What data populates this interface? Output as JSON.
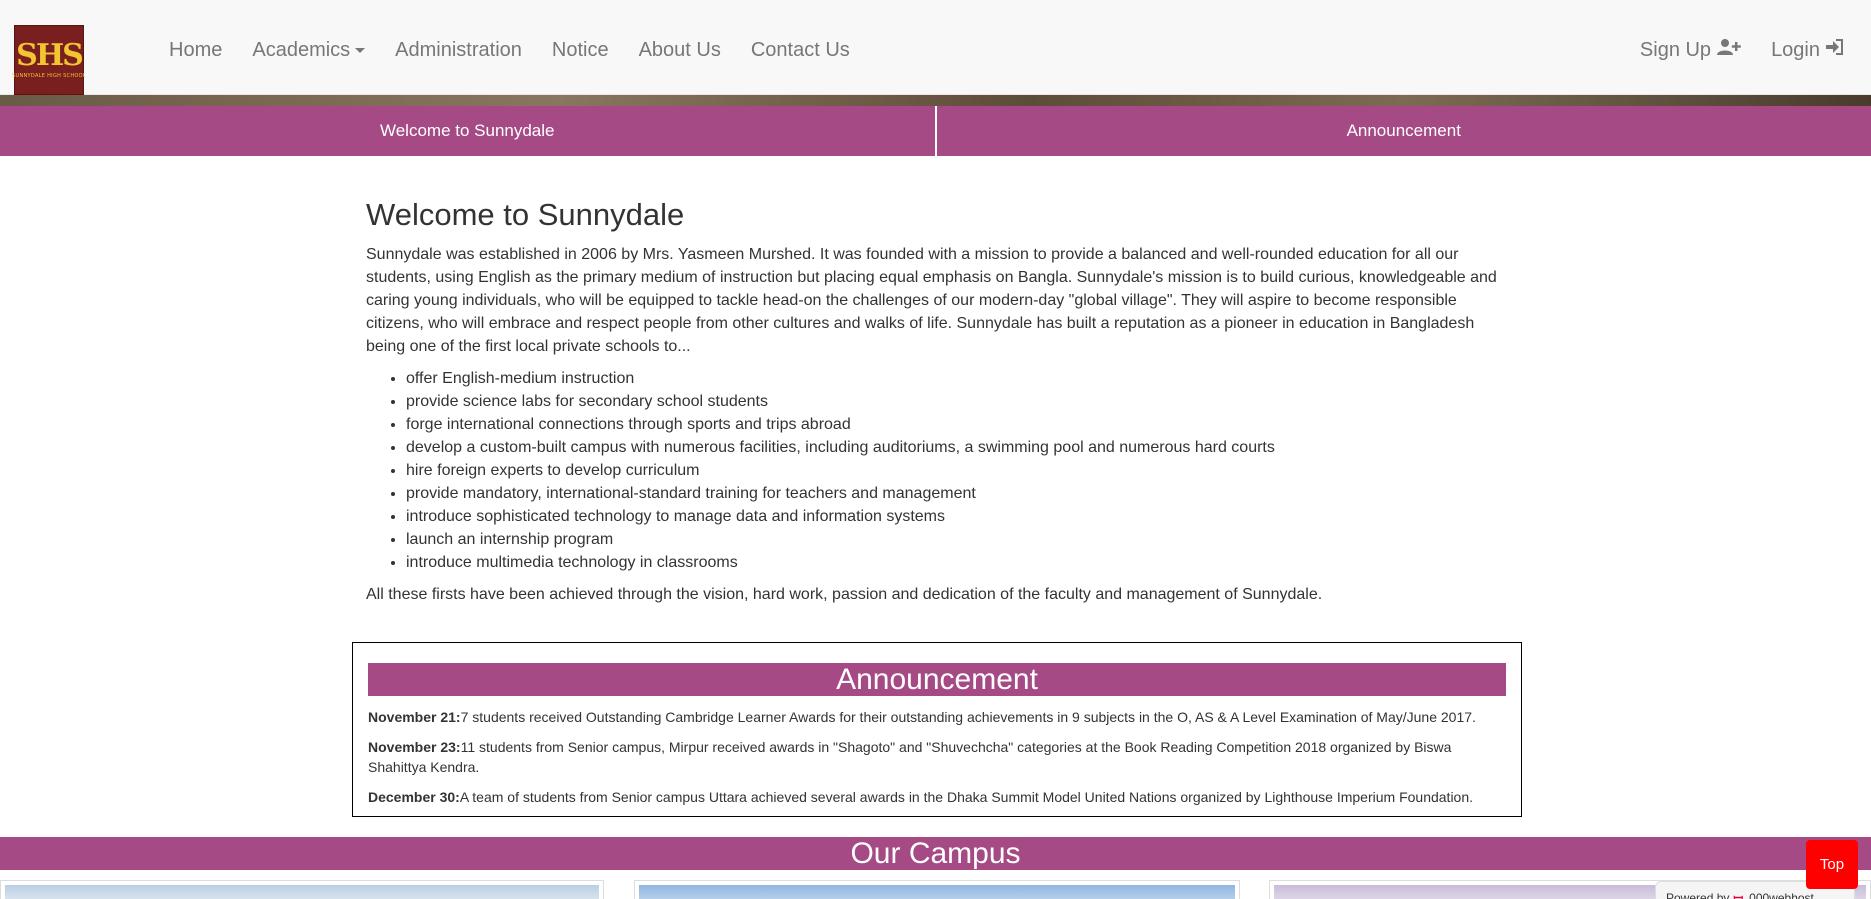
{
  "logo": {
    "mark": "SHS",
    "subtitle": "SUNNYDALE HIGH SCHOOL"
  },
  "nav": {
    "home": "Home",
    "academics": "Academics",
    "administration": "Administration",
    "notice": "Notice",
    "about": "About Us",
    "contact": "Contact Us",
    "signup": "Sign Up",
    "login": "Login"
  },
  "tabs": {
    "welcome": "Welcome to Sunnydale",
    "announcement": "Announcement"
  },
  "welcome": {
    "heading": "Welcome to Sunnydale",
    "intro": "Sunnydale was established in 2006 by Mrs. Yasmeen Murshed. It was founded with a mission to provide a balanced and well-rounded education for all our students, using English as the primary medium of instruction but placing equal emphasis on Bangla. Sunnydale's mission is to build curious, knowledgeable and caring young individuals, who will be equipped to tackle head-on the challenges of our modern-day \"global village\". They will aspire to become responsible citizens, who will embrace and respect people from other cultures and walks of life. Sunnydale has built a reputation as a pioneer in education in Bangladesh being one of the first local private schools to...",
    "items": [
      "offer English-medium instruction",
      "provide science labs for secondary school students",
      "forge international connections through sports and trips abroad",
      "develop a custom-built campus with numerous facilities, including auditoriums, a swimming pool and numerous hard courts",
      "hire foreign experts to develop curriculum",
      "provide mandatory, international-standard training for teachers and management",
      "introduce sophisticated technology to manage data and information systems",
      "launch an internship program",
      "introduce multimedia technology in classrooms"
    ],
    "outro": "All these firsts have been achieved through the vision, hard work, passion and dedication of the faculty and management of Sunnydale."
  },
  "announcement": {
    "title": "Announcement",
    "items": [
      {
        "date": "November 21:",
        "text": "7 students received Outstanding Cambridge Learner Awards for their outstanding achievements in 9 subjects in the O, AS & A Level Examination of May/June 2017."
      },
      {
        "date": "November 23:",
        "text": "11 students from Senior campus, Mirpur received awards in \"Shagoto\" and \"Shuvechcha\" categories at the Book Reading Competition 2018 organized by Biswa Shahittya Kendra."
      },
      {
        "date": "December 30:",
        "text": "A team of students from Senior campus Uttara achieved several awards in the Dhaka Summit Model United Nations organized by Lighthouse Imperium Foundation."
      }
    ]
  },
  "campus": {
    "title": "Our Campus"
  },
  "top_button": "Top",
  "powered": {
    "label": "Powered by",
    "brand": "000webhost"
  },
  "colors": {
    "accent": "#a54a85",
    "top_button": "#ff0000",
    "logo_bg": "#7a1f1f",
    "logo_text": "#f2c531"
  }
}
